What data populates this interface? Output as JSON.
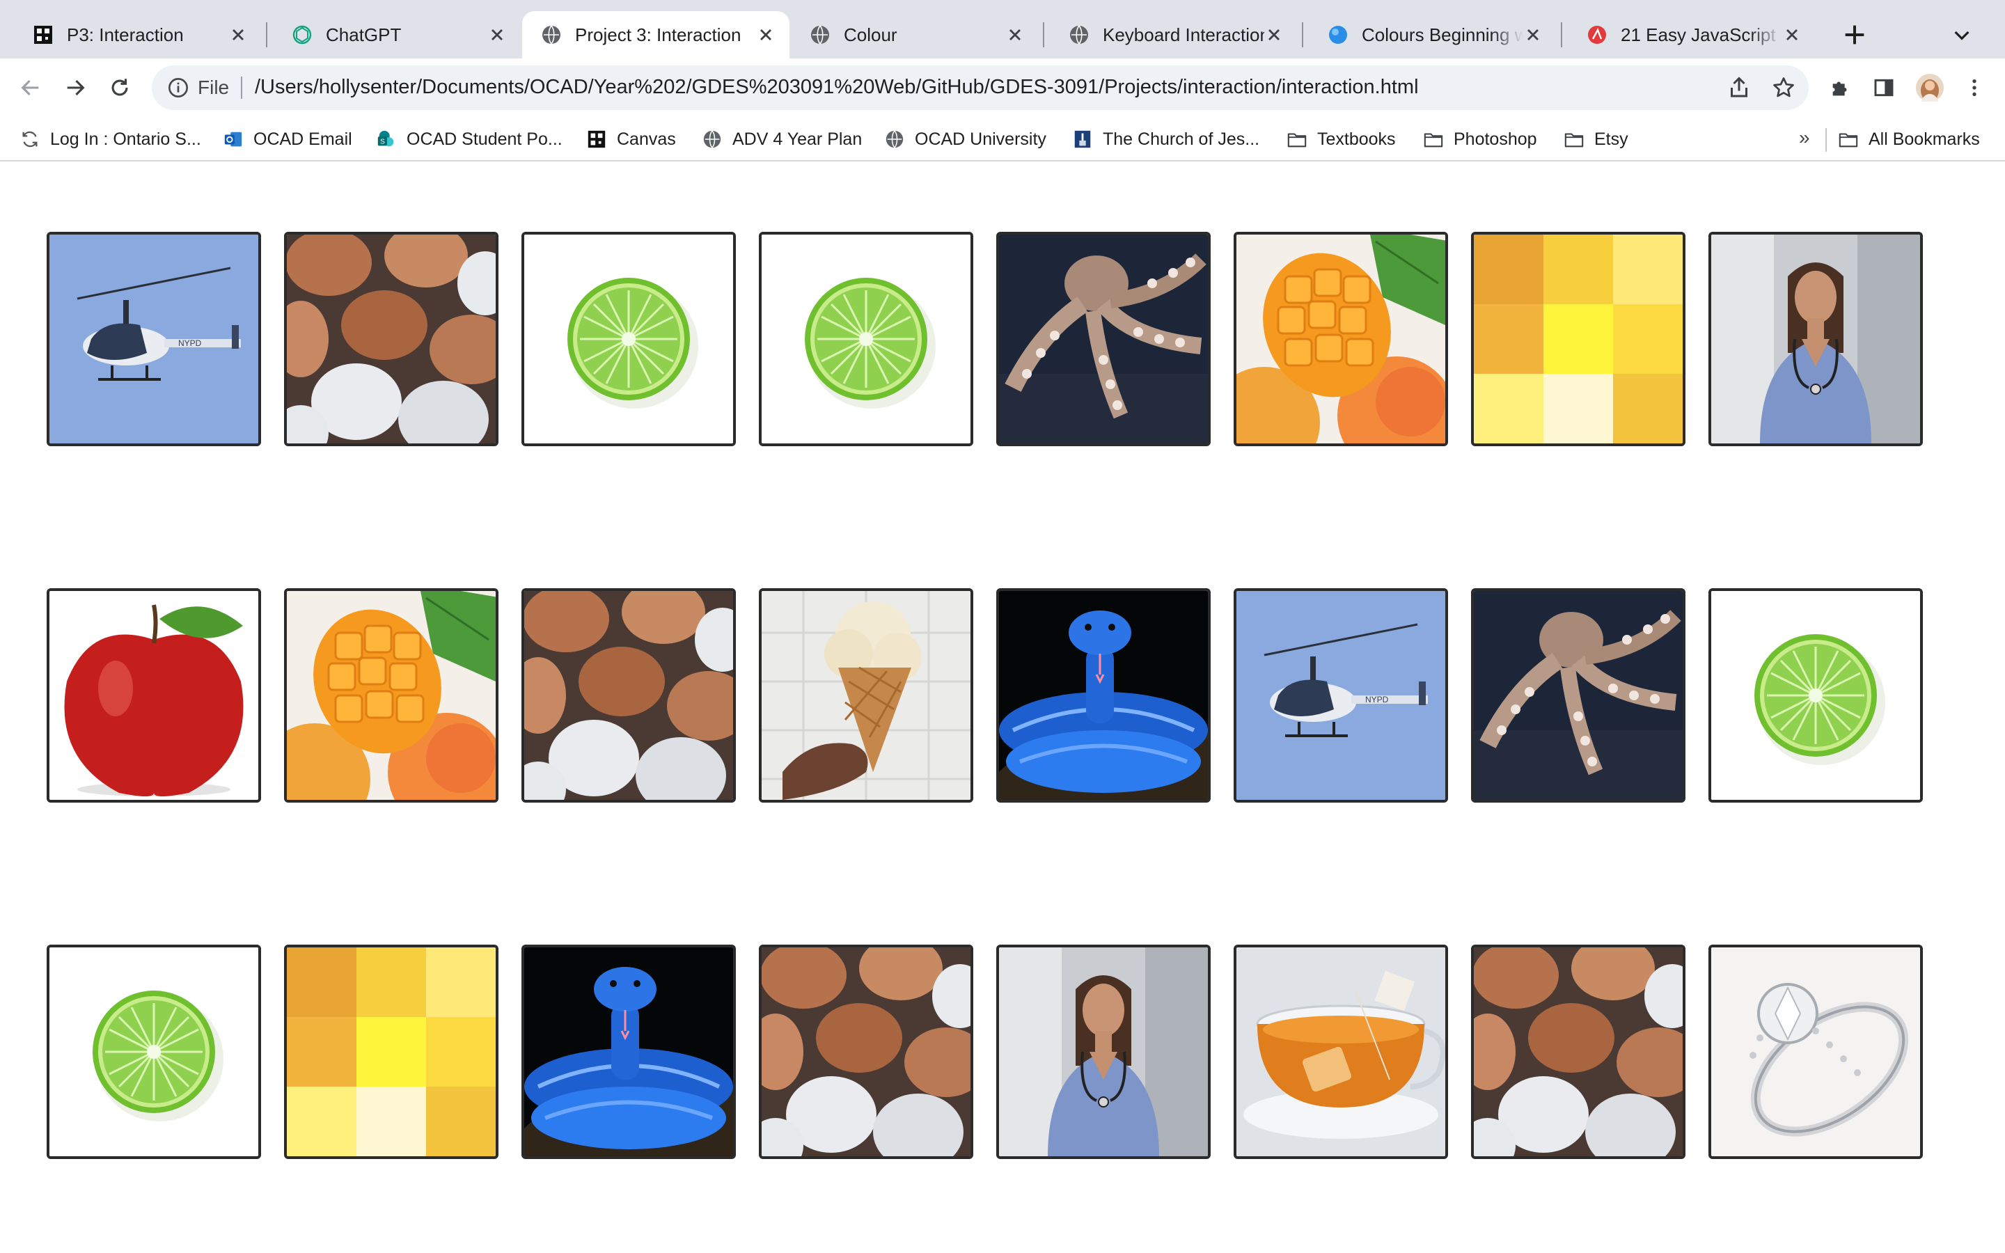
{
  "tabs": [
    {
      "title": "P3: Interaction",
      "icon": "qr-icon"
    },
    {
      "title": "ChatGPT",
      "icon": "openai-icon"
    },
    {
      "title": "Project 3: Interaction",
      "icon": "globe-icon",
      "active": true
    },
    {
      "title": "Colour",
      "icon": "globe-icon"
    },
    {
      "title": "Keyboard Interaction",
      "icon": "globe-icon"
    },
    {
      "title": "Colours Beginning w",
      "icon": "blue-circle-icon"
    },
    {
      "title": "21 Easy JavaScript P",
      "icon": "red-logo-icon"
    }
  ],
  "address_bar": {
    "scheme_label": "File",
    "url": "/Users/hollysenter/Documents/OCAD/Year%202/GDES%203091%20Web/GitHub/GDES-3091/Projects/interaction/interaction.html"
  },
  "bookmarks": [
    {
      "label": "Log In : Ontario S...",
      "icon": "sync-icon"
    },
    {
      "label": "OCAD Email",
      "icon": "outlook-icon"
    },
    {
      "label": "OCAD Student Po...",
      "icon": "sharepoint-icon"
    },
    {
      "label": "Canvas",
      "icon": "qr-icon"
    },
    {
      "label": "ADV 4 Year Plan",
      "icon": "globe-icon"
    },
    {
      "label": "OCAD University",
      "icon": "globe-icon"
    },
    {
      "label": "The Church of Jes...",
      "icon": "church-icon"
    },
    {
      "label": "Textbooks",
      "icon": "folder-icon"
    },
    {
      "label": "Photoshop",
      "icon": "folder-icon"
    },
    {
      "label": "Etsy",
      "icon": "folder-icon"
    }
  ],
  "bookmarks_overflow": "»",
  "all_bookmarks_label": "All Bookmarks",
  "grid": {
    "rows": [
      [
        "helicopter",
        "eggs",
        "lime",
        "lime",
        "octopus",
        "mango",
        "yellow-swatches",
        "nurse"
      ],
      [
        "apple",
        "mango",
        "eggs",
        "ice-cream",
        "blue-snake",
        "helicopter",
        "octopus",
        "lime"
      ],
      [
        "lime",
        "yellow-swatches",
        "blue-snake",
        "eggs",
        "nurse",
        "tea",
        "eggs",
        "ring"
      ]
    ]
  },
  "colors": {
    "tabstrip": "#dfe3e9",
    "card_border": "#2b2b2b",
    "sky": "#8aa9de",
    "lime": "#8fd14f"
  }
}
